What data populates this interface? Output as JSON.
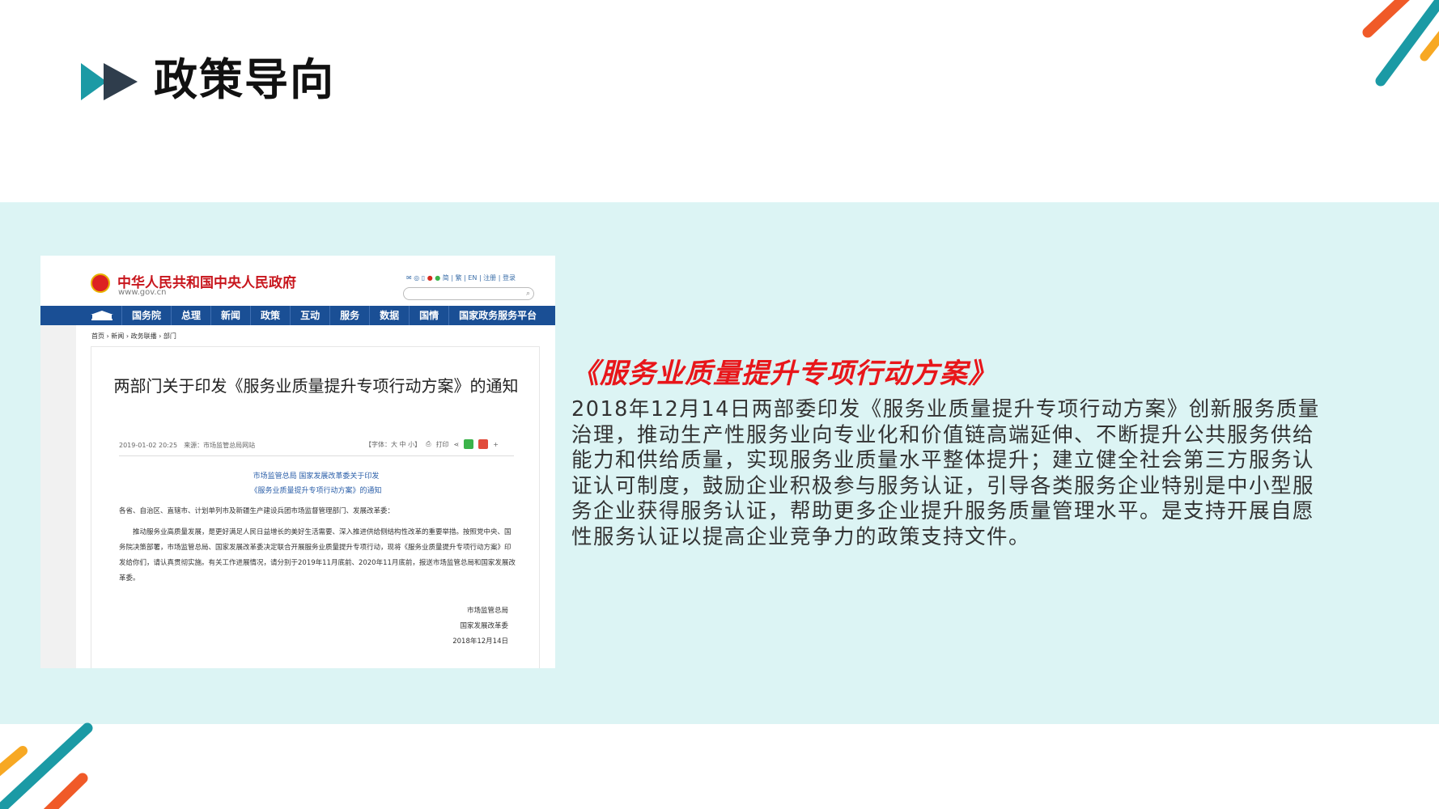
{
  "slide": {
    "title": "政策导向",
    "heading": "《服务业质量提升专项行动方案》",
    "body": "2018年12月14日两部委印发《服务业质量提升专项行动方案》创新服务质量治理，推动生产性服务业向专业化和价值链高端延伸、不断提升公共服务供给能力和供给质量，实现服务业质量水平整体提升；建立健全社会第三方服务认证认可制度，鼓励企业积极参与服务认证，引导各类服务企业特别是中小型服务企业获得服务认证，帮助更多企业提升服务质量管理水平。是支持开展自愿性服务认证以提高企业竞争力的政策支持文件。"
  },
  "colors": {
    "band": "#dcf4f4",
    "teal": "#1b9aa5",
    "dark": "#2f3d4c",
    "orange": "#f05a28",
    "yellow": "#f7a823",
    "red": "#e8161a",
    "nav": "#1a4f95"
  },
  "screenshot": {
    "site_name": "中华人民共和国中央人民政府",
    "site_url": "www.gov.cn",
    "top_links": "简 | 繁 | EN | 注册 | 登录",
    "nav": [
      "国务院",
      "总理",
      "新闻",
      "政策",
      "互动",
      "服务",
      "数据",
      "国情",
      "国家政务服务平台"
    ],
    "breadcrumb": "首页 › 新闻 › 政务联播 › 部门",
    "article_title": "两部门关于印发《服务业质量提升专项行动方案》的通知",
    "meta": "2019-01-02 20:25　来源：市场监管总局网站",
    "font_size_label": "【字体：大 中 小】",
    "print_label": "打印",
    "subtitle_1": "市场监管总局 国家发展改革委关于印发",
    "subtitle_2": "《服务业质量提升专项行动方案》的通知",
    "greeting": "各省、自治区、直辖市、计划单列市及新疆生产建设兵团市场监督管理部门、发展改革委：",
    "paragraph": "推动服务业高质量发展，是更好满足人民日益增长的美好生活需要、深入推进供给侧结构性改革的重要举措。按照党中央、国务院决策部署，市场监管总局、国家发展改革委决定联合开展服务业质量提升专项行动，现将《服务业质量提升专项行动方案》印发给你们，请认真贯彻实施。有关工作进展情况，请分别于2019年11月底前、2020年11月底前，报送市场监管总局和国家发展改革委。",
    "signers": [
      "市场监管总局",
      "国家发展改革委",
      "2018年12月14日"
    ]
  }
}
